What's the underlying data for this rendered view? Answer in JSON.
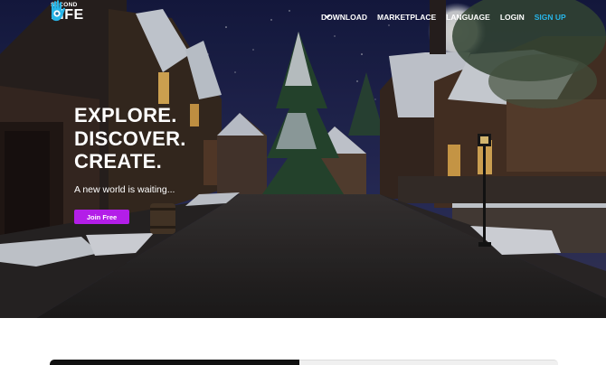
{
  "brand": {
    "small": "SECOND",
    "big": "LIFE",
    "logo_icon": "hand-eye-icon"
  },
  "nav": {
    "download": "DOWNLOAD",
    "marketplace": "MARKETPLACE",
    "language": "LANGUAGE",
    "login": "LOGIN",
    "signup": "SIGN UP"
  },
  "hero": {
    "headline_1": "EXPLORE.",
    "headline_2": "DISCOVER.",
    "headline_3": "CREATE.",
    "tagline": "A new world is waiting...",
    "cta": "Join Free"
  },
  "colors": {
    "accent": "#b31ee8",
    "signup": "#27b5e8",
    "night_sky": "#141a3a"
  }
}
